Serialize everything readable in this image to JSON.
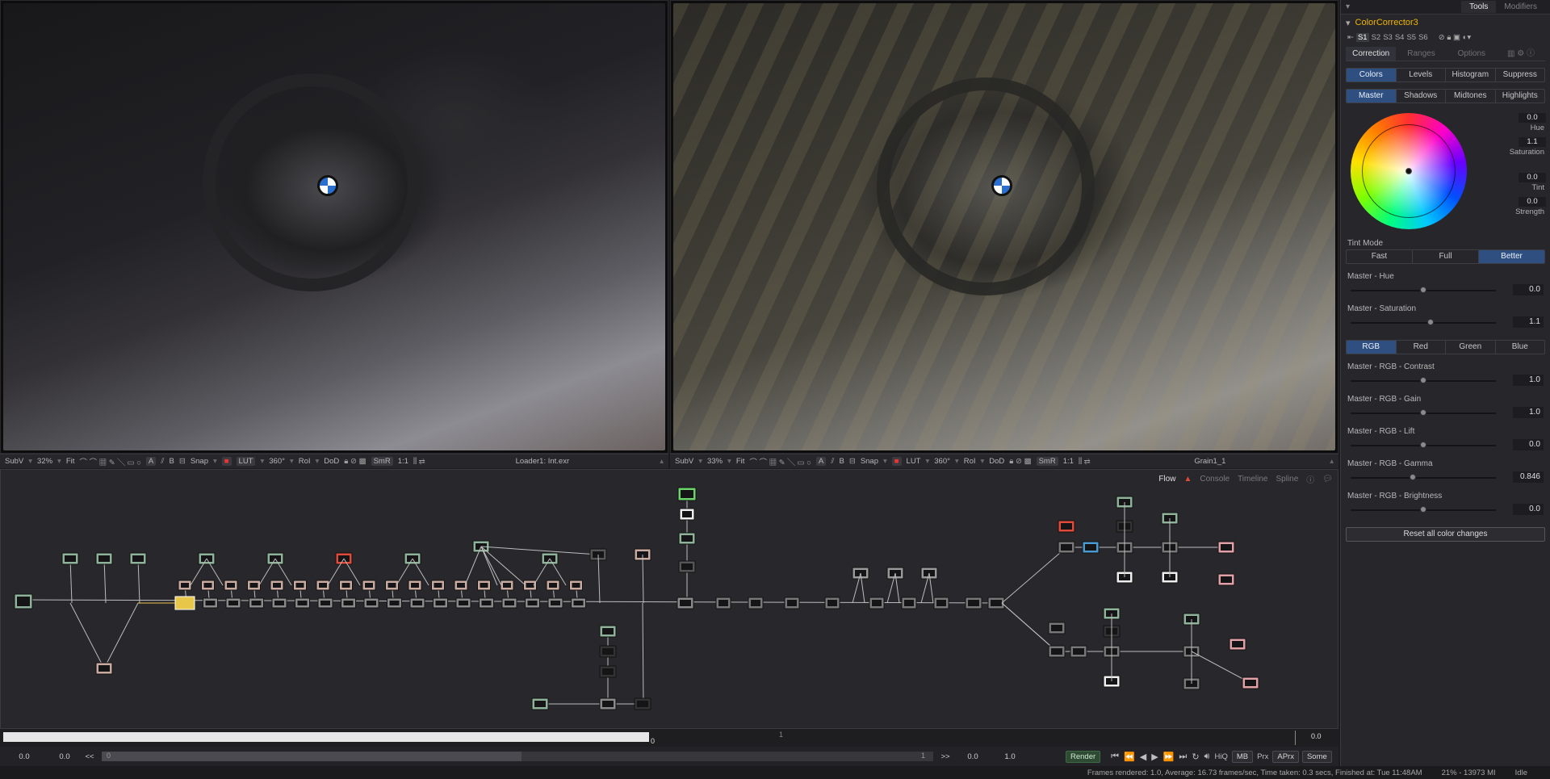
{
  "viewers": {
    "left": {
      "subview": "SubV",
      "zoom": "32%",
      "fit": "Fit",
      "channel_a": "A",
      "channel_b": "B",
      "snap": "Snap",
      "lut": "LUT",
      "angle": "360°",
      "roi": "RoI",
      "dod": "DoD",
      "smr": "SmR",
      "ratio": "1:1",
      "source": "Loader1: Int.exr"
    },
    "right": {
      "subview": "SubV",
      "zoom": "33%",
      "fit": "Fit",
      "channel_a": "A",
      "channel_b": "B",
      "snap": "Snap",
      "lut": "LUT",
      "angle": "360°",
      "roi": "RoI",
      "dod": "DoD",
      "smr": "SmR",
      "ratio": "1:1",
      "source": "Grain1_1"
    }
  },
  "flow_tabs": [
    "Flow",
    "Console",
    "Timeline",
    "Spline"
  ],
  "time_ruler": {
    "start_marker": "0",
    "mid_marker": "1",
    "end_value": "0.0"
  },
  "transport": {
    "global_start": "0.0",
    "render_start": "0.0",
    "prev_label": "<<",
    "scrub_start": "0",
    "scrub_end": "1",
    "next_label": ">>",
    "render_end": "0.0",
    "global_end": "1.0",
    "render_button": "Render",
    "hiq": "HiQ",
    "mb": "MB",
    "prx": "Prx",
    "aprx": "APrx",
    "some": "Some"
  },
  "status": {
    "frames": "Frames rendered: 1.0,  Average: 16.73 frames/sec,  Time taken: 0.3 secs,  Finished at: Tue 11:48AM",
    "memory": "21% - 13973 MI",
    "state": "Idle"
  },
  "inspector": {
    "tabs": [
      "Tools",
      "Modifiers"
    ],
    "tool_name": "ColorCorrector3",
    "versions": [
      "S1",
      "S2",
      "S3",
      "S4",
      "S5",
      "S6"
    ],
    "main_tabs": [
      "Correction",
      "Ranges",
      "Options"
    ],
    "mode_buttons": [
      "Colors",
      "Levels",
      "Histogram",
      "Suppress"
    ],
    "range_buttons": [
      "Master",
      "Shadows",
      "Midtones",
      "Highlights"
    ],
    "wheel": {
      "hue_value": "0.0",
      "hue_label": "Hue",
      "saturation_value": "1.1",
      "saturation_label": "Saturation",
      "tint_value": "0.0",
      "tint_label": "Tint",
      "strength_value": "0.0",
      "strength_label": "Strength"
    },
    "tint_mode_label": "Tint Mode",
    "tint_modes": [
      "Fast",
      "Full",
      "Better"
    ],
    "sliders_top": [
      {
        "label": "Master - Hue",
        "value": "0.0",
        "level": 0.5
      },
      {
        "label": "Master - Saturation",
        "value": "1.1",
        "level": 0.55
      }
    ],
    "channel_buttons": [
      "RGB",
      "Red",
      "Green",
      "Blue"
    ],
    "sliders_rgb": [
      {
        "label": "Master - RGB - Contrast",
        "value": "1.0",
        "level": 0.5
      },
      {
        "label": "Master - RGB - Gain",
        "value": "1.0",
        "level": 0.5
      },
      {
        "label": "Master - RGB - Lift",
        "value": "0.0",
        "level": 0.5
      },
      {
        "label": "Master - RGB - Gamma",
        "value": "0.846",
        "level": 0.43
      },
      {
        "label": "Master - RGB - Brightness",
        "value": "0.0",
        "level": 0.5
      }
    ],
    "reset_button": "Reset all color changes"
  },
  "colors": {
    "accent_blue": "#2e4f80",
    "tool_title": "#f0b400",
    "render_green": "#2f4a33",
    "selected_node": "#e8c64a"
  }
}
